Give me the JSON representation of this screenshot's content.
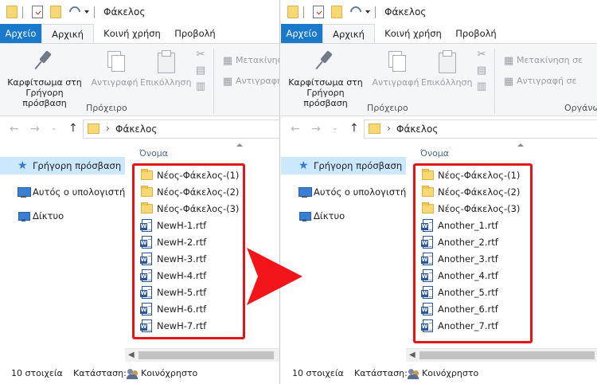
{
  "left_window": {
    "title": "Φάκελος",
    "tabs": [
      {
        "label": "Αρχείο"
      },
      {
        "label": "Αρχική"
      },
      {
        "label": "Κοινή χρήση"
      },
      {
        "label": "Προβολή"
      }
    ],
    "ribbon": {
      "pin_label": "Καρφίτσωμα στη Γρήγορη πρόσβαση",
      "copy_label": "Αντιγραφή",
      "paste_label": "Επικόλληση",
      "move_label": "Μετακίνηση",
      "copyto_label": "Αντιγραφή",
      "group_label": "Πρόχειρο"
    },
    "address": "Φάκελος",
    "nav_pane": [
      {
        "label": "Γρήγορη πρόσβαση",
        "icon": "star-icon"
      },
      {
        "label": "Αυτός ο υπολογιστής",
        "icon": "computer-icon"
      },
      {
        "label": "Δίκτυο",
        "icon": "network-icon"
      }
    ],
    "column_header": "Όνομα",
    "files": [
      {
        "name": "Νέος-Φάκελος-(1)",
        "type": "folder"
      },
      {
        "name": "Νέος-Φάκελος-(2)",
        "type": "folder"
      },
      {
        "name": "Νέος-Φάκελος-(3)",
        "type": "folder"
      },
      {
        "name": "NewH-1.rtf",
        "type": "rtf"
      },
      {
        "name": "NewH-2.rtf",
        "type": "rtf"
      },
      {
        "name": "NewH-3.rtf",
        "type": "rtf"
      },
      {
        "name": "NewH-4.rtf",
        "type": "rtf"
      },
      {
        "name": "NewH-5.rtf",
        "type": "rtf"
      },
      {
        "name": "NewH-6.rtf",
        "type": "rtf"
      },
      {
        "name": "NewH-7.rtf",
        "type": "rtf"
      }
    ],
    "status": {
      "count": "10 στοιχεία",
      "state_label": "Κατάσταση:",
      "shared": "Κοινόχρηστο"
    }
  },
  "right_window": {
    "title": "Φάκελος",
    "tabs": [
      {
        "label": "Αρχείο"
      },
      {
        "label": "Αρχική"
      },
      {
        "label": "Κοινή χρήση"
      },
      {
        "label": "Προβολή"
      }
    ],
    "ribbon": {
      "pin_label": "Καρφίτσωμα στη Γρήγορη πρόσβαση",
      "copy_label": "Αντιγραφή",
      "paste_label": "Επικόλληση",
      "move_label": "Μετακίνηση σε",
      "copyto_label": "Αντιγραφή σε",
      "group_label": "Πρόχειρο",
      "group2_label": "Οργάνω"
    },
    "address": "Φάκελος",
    "nav_pane": [
      {
        "label": "Γρήγορη πρόσβαση",
        "icon": "star-icon"
      },
      {
        "label": "Αυτός ο υπολογιστής",
        "icon": "computer-icon"
      },
      {
        "label": "Δίκτυο",
        "icon": "network-icon"
      }
    ],
    "column_header": "Όνομα",
    "files": [
      {
        "name": "Νέος-Φάκελος-(1)",
        "type": "folder"
      },
      {
        "name": "Νέος-Φάκελος-(2)",
        "type": "folder"
      },
      {
        "name": "Νέος-Φάκελος-(3)",
        "type": "folder"
      },
      {
        "name": "Another_1.rtf",
        "type": "rtf"
      },
      {
        "name": "Another_2.rtf",
        "type": "rtf"
      },
      {
        "name": "Another_3.rtf",
        "type": "rtf"
      },
      {
        "name": "Another_4.rtf",
        "type": "rtf"
      },
      {
        "name": "Another_5.rtf",
        "type": "rtf"
      },
      {
        "name": "Another_6.rtf",
        "type": "rtf"
      },
      {
        "name": "Another_7.rtf",
        "type": "rtf"
      }
    ],
    "status": {
      "count": "10 στοιχεία",
      "state_label": "Κατάσταση:",
      "shared": "Κοινόχρηστο"
    }
  },
  "colors": {
    "file_tab": "#1979ca",
    "highlight_box": "#e3141a",
    "arrow": "#f2161b",
    "nav_selected": "#cce8ff"
  }
}
